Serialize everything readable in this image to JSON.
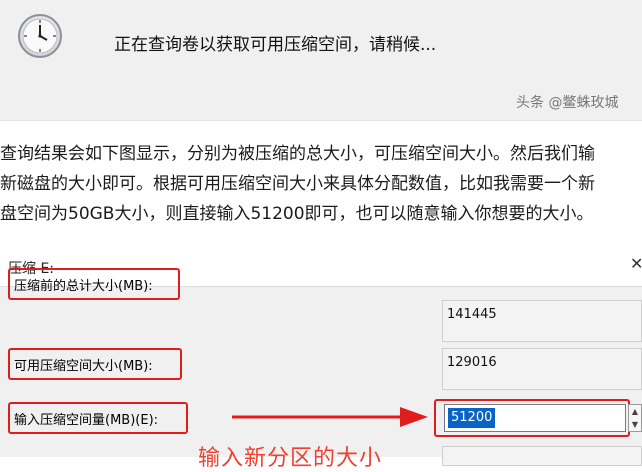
{
  "top_panel": {
    "icon": "clock-icon",
    "loading_text": "正在查询卷以获取可用压缩空间，请稍候...",
    "watermark": "头条 @鳖蛛玫城"
  },
  "article": {
    "lines": [
      "查询结果会如下图显示，分别为被压缩的总大小，可压缩空间大小。然后我们输",
      "新磁盘的大小即可。根据可用压缩空间大小来具体分配数值，比如我需要一个新",
      "盘空间为50GB大小，则直接输入51200即可，也可以随意输入你想要的大小。"
    ]
  },
  "dialog": {
    "title": "压缩 E:",
    "close_icon": "close-icon",
    "fields": [
      {
        "label": "压缩前的总计大小(MB):",
        "value": "141445"
      },
      {
        "label": "可用压缩空间大小(MB):",
        "value": "129016"
      },
      {
        "label": "输入压缩空间量(MB)(E):",
        "value": "51200"
      }
    ],
    "annotation": "输入新分区的大小",
    "accent_color": "#e01d1d",
    "selection_color": "#0a64c8"
  }
}
